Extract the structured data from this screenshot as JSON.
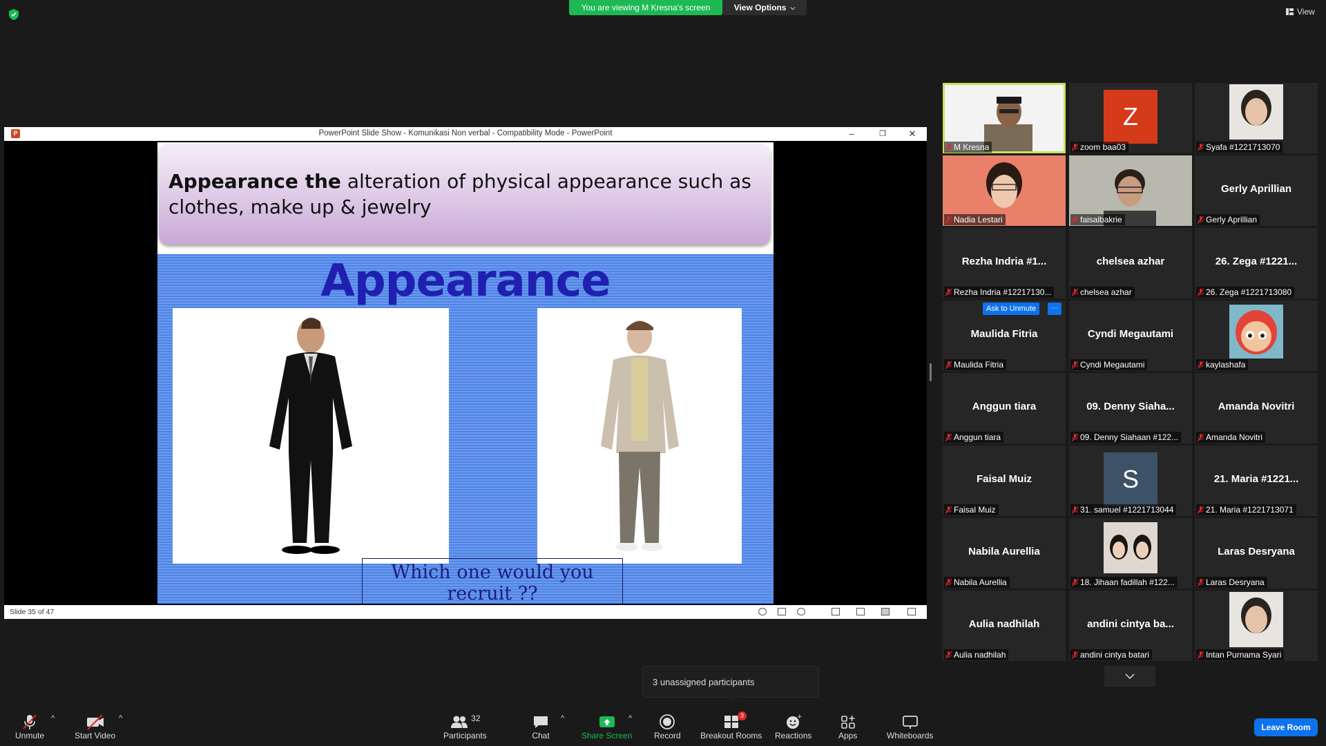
{
  "top_bar": {
    "viewing_banner": "You are viewing M Kresna's screen",
    "view_options_label": "View Options",
    "view_label": "View"
  },
  "shared_window": {
    "title": "PowerPoint Slide Show  -  Komunikasi Non verbal  -  Compatibility Mode - PowerPoint",
    "app_icon_text": "P",
    "slide": {
      "header_bold": "Appearance the",
      "header_rest": " alteration of physical appearance such as clothes, make up & jewelry",
      "body_title": "Appearance",
      "question_line1": "Which one would you",
      "question_line2": "recruit ??"
    },
    "status": {
      "slide_counter": "Slide 35 of 47"
    }
  },
  "gallery": {
    "tiles": [
      {
        "label": "M Kresna",
        "display": "",
        "type": "video"
      },
      {
        "label": "zoom baa03",
        "display": "Z",
        "type": "letter",
        "color": "#d53a1a"
      },
      {
        "label": "Syafa #1221713070",
        "display": "",
        "type": "photo"
      },
      {
        "label": "Nadia Lestari",
        "display": "",
        "type": "video"
      },
      {
        "label": "faisalbakrie",
        "display": "",
        "type": "video"
      },
      {
        "label": "Gerly Aprillian",
        "display": "Gerly Aprillian",
        "type": "name"
      },
      {
        "label": "Rezha Indria #12217130...",
        "display": "Rezha Indria #1...",
        "type": "name"
      },
      {
        "label": "chelsea azhar",
        "display": "chelsea azhar",
        "type": "name"
      },
      {
        "label": "26. Zega #1221713080",
        "display": "26. Zega #1221...",
        "type": "name"
      },
      {
        "label": "Maulida Fitria",
        "display": "Maulida Fitria",
        "type": "name"
      },
      {
        "label": "Cyndi Megautami",
        "display": "Cyndi Megautami",
        "type": "name"
      },
      {
        "label": "kaylashafa",
        "display": "",
        "type": "cartoon"
      },
      {
        "label": "Anggun tiara",
        "display": "Anggun tiara",
        "type": "name"
      },
      {
        "label": "09. Denny Siahaan #122...",
        "display": "09.  Denny  Siaha...",
        "type": "name"
      },
      {
        "label": "Amanda Novitri",
        "display": "Amanda Novitri",
        "type": "name"
      },
      {
        "label": "Faisal Muiz",
        "display": "Faisal Muiz",
        "type": "name"
      },
      {
        "label": "31. samuel #1221713044",
        "display": "S",
        "type": "letter",
        "color": "#3d5266"
      },
      {
        "label": "21. Maria #1221713071",
        "display": "21. Maria #1221...",
        "type": "name"
      },
      {
        "label": "Nabila Aurellia",
        "display": "Nabila Aurellia",
        "type": "name"
      },
      {
        "label": "18. Jihaan fadillah #122...",
        "display": "",
        "type": "photo2"
      },
      {
        "label": "Laras Desryana",
        "display": "Laras Desryana",
        "type": "name"
      },
      {
        "label": "Aulia nadhilah",
        "display": "Aulia nadhilah",
        "type": "name"
      },
      {
        "label": "andini cintya batari",
        "display": "andini  cintya  ba...",
        "type": "name"
      },
      {
        "label": "Intan Purnama Syari",
        "display": "",
        "type": "photo"
      }
    ],
    "ask_to_unmute": "Ask to Unmute",
    "more": "···"
  },
  "toast": {
    "text": "3 unassigned participants"
  },
  "toolbar": {
    "unmute": "Unmute",
    "start_video": "Start Video",
    "participants": "Participants",
    "participants_count": "32",
    "chat": "Chat",
    "share_screen": "Share Screen",
    "record": "Record",
    "breakout_rooms": "Breakout Rooms",
    "breakout_badge": "3",
    "reactions": "Reactions",
    "apps": "Apps",
    "whiteboards": "Whiteboards",
    "leave_room": "Leave Room"
  },
  "colors": {
    "accent_blue": "#0e72ed",
    "share_green": "#1db954",
    "active_speaker": "#c9e15e"
  }
}
